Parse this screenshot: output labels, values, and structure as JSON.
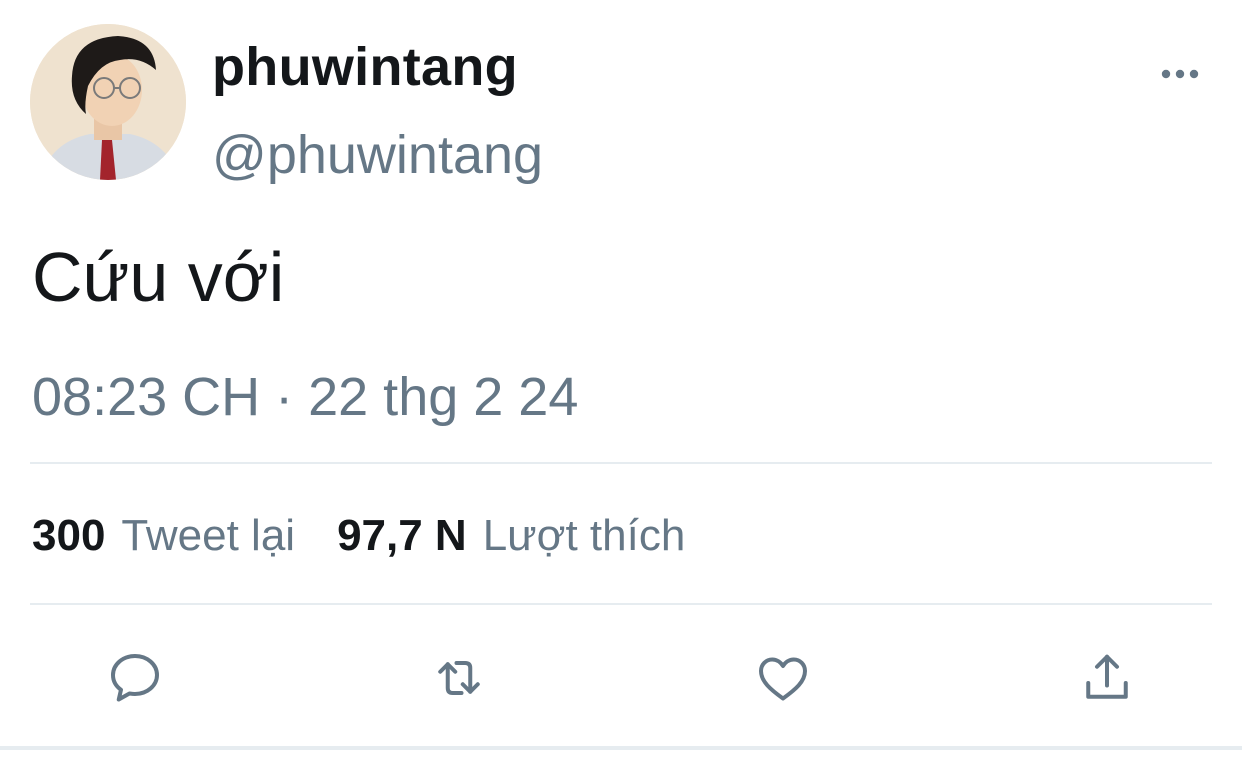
{
  "author": {
    "display_name": "phuwintang",
    "handle": "@phuwintang"
  },
  "tweet": {
    "text": "Cứu với",
    "timestamp": "08:23 CH · 22 thg 2 24"
  },
  "stats": {
    "retweets_count": "300",
    "retweets_label": "Tweet lại",
    "likes_count": "97,7 N",
    "likes_label": "Lượt thích"
  },
  "actions": {
    "reply_icon": "reply-icon",
    "retweet_icon": "retweet-icon",
    "like_icon": "heart-icon",
    "share_icon": "share-icon"
  },
  "colors": {
    "primary_text": "#14171a",
    "secondary_text": "#657786",
    "divider": "#e6ecf0"
  }
}
